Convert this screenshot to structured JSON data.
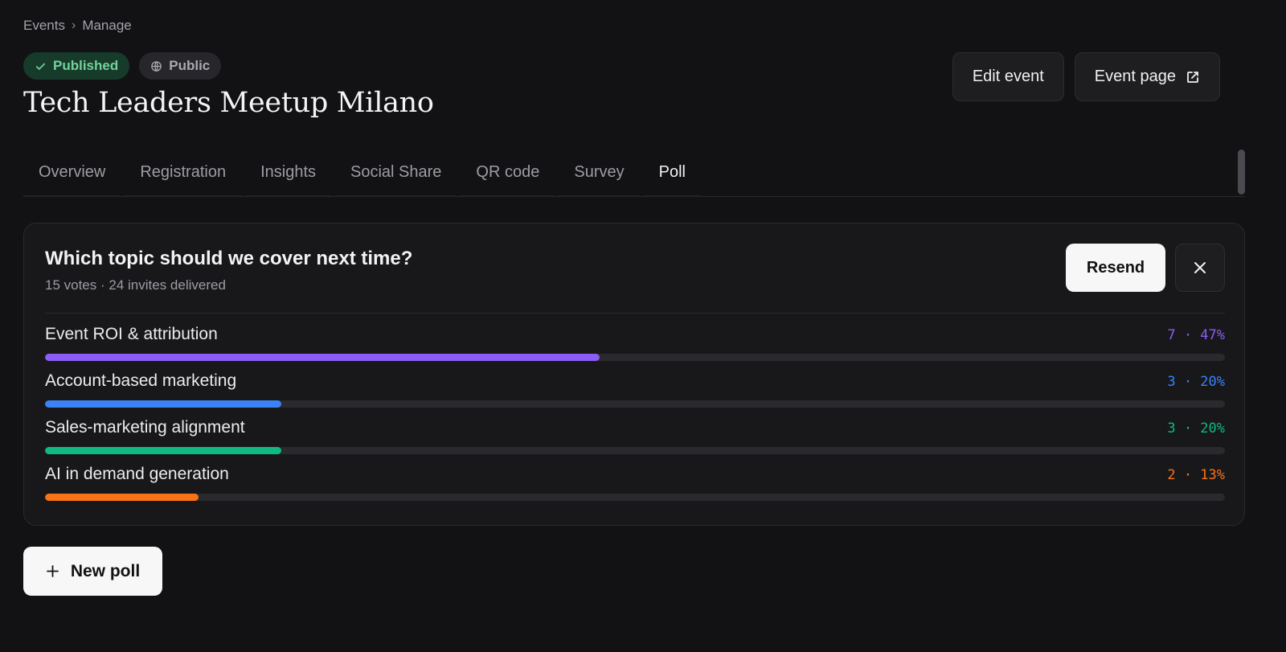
{
  "breadcrumb": {
    "items": [
      "Events",
      "Manage"
    ],
    "separator": "›"
  },
  "badges": {
    "published": "Published",
    "public": "Public"
  },
  "page_title": "Tech Leaders Meetup Milano",
  "actions": {
    "edit_event": "Edit event",
    "event_page": "Event page"
  },
  "tabs": [
    "Overview",
    "Registration",
    "Insights",
    "Social Share",
    "QR code",
    "Survey",
    "Poll"
  ],
  "active_tab": "Poll",
  "poll": {
    "question": "Which topic should we cover next time?",
    "meta": "15 votes · 24 invites delivered",
    "resend_label": "Resend",
    "options": [
      {
        "label": "Event ROI & attribution",
        "stat": "7 · 47%",
        "fraction": 0.47,
        "color": "#8b5cf6"
      },
      {
        "label": "Account-based marketing",
        "stat": "3 · 20%",
        "fraction": 0.2,
        "color": "#3b82f6"
      },
      {
        "label": "Sales-marketing alignment",
        "stat": "3 · 20%",
        "fraction": 0.2,
        "color": "#10b981"
      },
      {
        "label": "AI in demand generation",
        "stat": "2 · 13%",
        "fraction": 0.13,
        "color": "#f97316"
      }
    ]
  },
  "new_poll_label": "New poll",
  "colors": {
    "background": "#121214",
    "card": "#18181b",
    "published": "#74d19a"
  },
  "icons": {
    "published": "check-icon",
    "public": "globe-icon",
    "event_page": "external-link-icon",
    "close": "close-icon",
    "new_poll": "plus-icon"
  }
}
